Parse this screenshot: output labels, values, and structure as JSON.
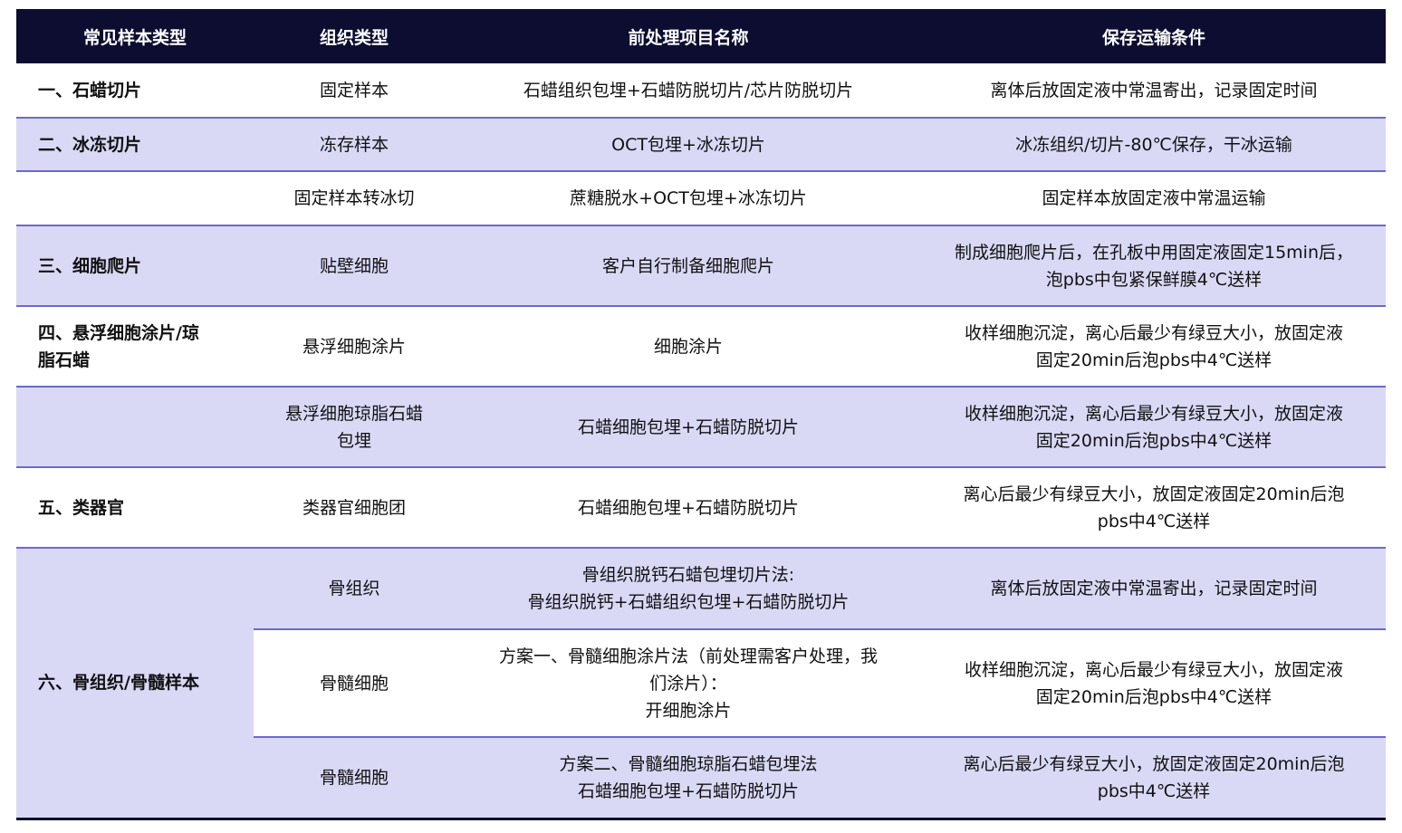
{
  "header": {
    "col1": "常见样本类型",
    "col2": "组织类型",
    "col3": "前处理项目名称",
    "col4": "保存运输条件"
  },
  "rows": [
    {
      "category": "一、石蜡切片",
      "tissue": "固定样本",
      "process": "石蜡组织包埋+石蜡防脱切片/芯片防脱切片",
      "storage": "离体后放固定液中常温寄出，记录固定时间"
    },
    {
      "category": "二、冰冻切片",
      "tissue": "冻存样本",
      "process": "OCT包埋+冰冻切片",
      "storage": "冰冻组织/切片-80℃保存，干冰运输"
    },
    {
      "category": "",
      "tissue": "固定样本转冰切",
      "process": "蔗糖脱水+OCT包埋+冰冻切片",
      "storage": "固定样本放固定液中常温运输"
    },
    {
      "category": "三、细胞爬片",
      "tissue": "贴壁细胞",
      "process": "客户自行制备细胞爬片",
      "storage": [
        "制成细胞爬片后，在孔板中用固定液固定15min后，",
        "泡pbs中包紧保鲜膜4℃送样"
      ]
    },
    {
      "category": [
        "四、悬浮细胞涂片/琼",
        "脂石蜡"
      ],
      "tissue": "悬浮细胞涂片",
      "process": "细胞涂片",
      "storage": [
        "收样细胞沉淀，离心后最少有绿豆大小，放固定液",
        "固定20min后泡pbs中4℃送样"
      ]
    },
    {
      "category": "",
      "tissue": [
        "悬浮细胞琼脂石蜡",
        "包埋"
      ],
      "process": "石蜡细胞包埋+石蜡防脱切片",
      "storage": [
        "收样细胞沉淀，离心后最少有绿豆大小，放固定液",
        "固定20min后泡pbs中4℃送样"
      ]
    },
    {
      "category": "五、类器官",
      "tissue": "类器官细胞团",
      "process": "石蜡细胞包埋+石蜡防脱切片",
      "storage": [
        "离心后最少有绿豆大小，放固定液固定20min后泡",
        "pbs中4℃送样"
      ]
    },
    {
      "category": "六、骨组织/骨髓样本",
      "tissue": "骨组织",
      "process": [
        "骨组织脱钙石蜡包埋切片法:",
        "骨组织脱钙+石蜡组织包埋+石蜡防脱切片"
      ],
      "storage": "离体后放固定液中常温寄出，记录固定时间"
    },
    {
      "category": "",
      "tissue": "骨髓细胞",
      "process": [
        "方案一、骨髓细胞涂片法（前处理需客户处理，我",
        "们涂片）：",
        "开细胞涂片"
      ],
      "storage": [
        "收样细胞沉淀，离心后最少有绿豆大小，放固定液",
        "固定20min后泡pbs中4℃送样"
      ]
    },
    {
      "category": "",
      "tissue": "骨髓细胞",
      "process": [
        "方案二、骨髓细胞琼脂石蜡包埋法",
        "石蜡细胞包埋+石蜡防脱切片"
      ],
      "storage": [
        "离心后最少有绿豆大小，放固定液固定20min后泡",
        "pbs中4℃送样"
      ]
    }
  ]
}
